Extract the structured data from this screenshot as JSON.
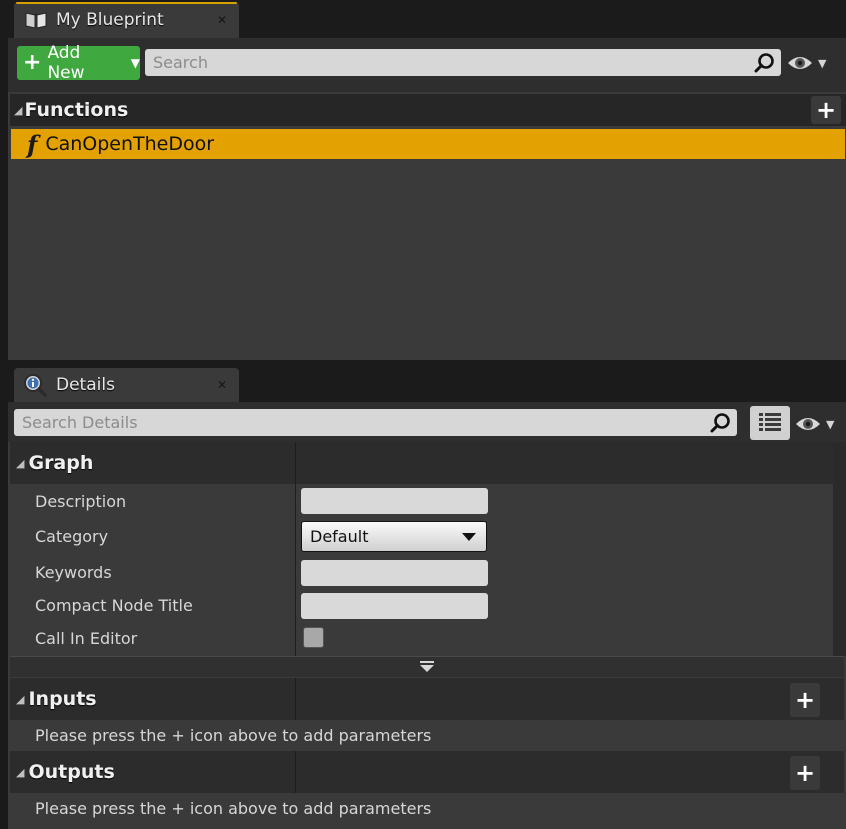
{
  "blueprint_tab": {
    "title": "My Blueprint",
    "close": "✕"
  },
  "blueprint_toolbar": {
    "add_new_label": "Add New",
    "search_placeholder": "Search"
  },
  "functions": {
    "category_label": "Functions",
    "items": [
      {
        "label": "CanOpenTheDoor",
        "selected": true
      }
    ]
  },
  "details_tab": {
    "title": "Details",
    "close": "✕"
  },
  "details_toolbar": {
    "search_placeholder": "Search Details"
  },
  "graph": {
    "section_label": "Graph",
    "properties": [
      {
        "label": "Description",
        "type": "text",
        "value": ""
      },
      {
        "label": "Category",
        "type": "dropdown",
        "value": "Default"
      },
      {
        "label": "Keywords",
        "type": "text",
        "value": ""
      },
      {
        "label": "Compact Node Title",
        "type": "text",
        "value": ""
      },
      {
        "label": "Call In Editor",
        "type": "checkbox",
        "value": false
      }
    ]
  },
  "inputs": {
    "section_label": "Inputs",
    "hint": "Please press the + icon above to add parameters"
  },
  "outputs": {
    "section_label": "Outputs",
    "hint": "Please press the + icon above to add parameters"
  },
  "colors": {
    "selection": "#e3a102",
    "add_button": "#3fa83e",
    "tab_accent": "#d7a200",
    "panel": "#3a3a3a"
  },
  "icons": {
    "tab_blueprint": "book-icon",
    "tab_details": "info-magnifier-icon",
    "function": "function-f-icon",
    "search": "magnifier-icon",
    "visibility": "eye-icon",
    "property_matrix": "grid-list-icon",
    "add": "plus-icon",
    "expand": "chevron-down-icon"
  }
}
